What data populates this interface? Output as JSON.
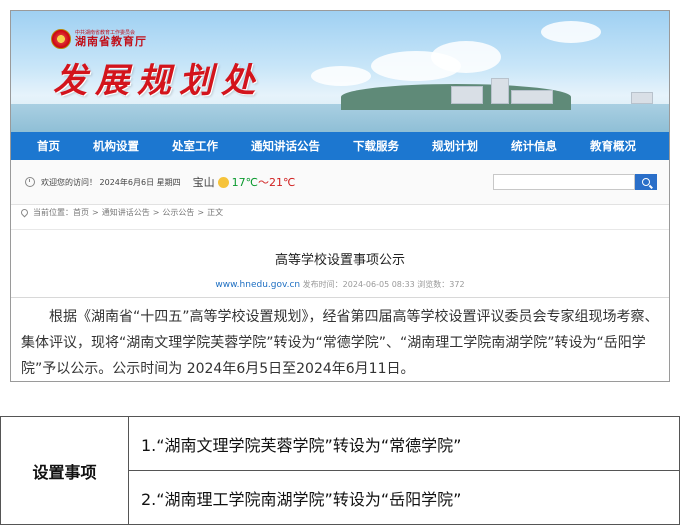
{
  "header": {
    "party_line": "中共湖南省教育工作委员会",
    "agency": "湖南省教育厅",
    "department": "发展规划处"
  },
  "nav": {
    "items": [
      "首页",
      "机构设置",
      "处室工作",
      "通知讲话公告",
      "下载服务",
      "规划计划",
      "统计信息",
      "教育概况"
    ]
  },
  "infobar": {
    "greeting": "欢迎您的访问！ 2024年6月6日 星期四",
    "city": "宝山",
    "temp_low": "17℃",
    "temp_sep": "～",
    "temp_high": "21℃",
    "search_placeholder": ""
  },
  "breadcrumb": {
    "label": "当前位置：",
    "items": [
      "首页",
      "通知讲话公告",
      "公示公告",
      "正文"
    ],
    "sep": ">"
  },
  "article": {
    "title": "高等学校设置事项公示",
    "site": "www.hnedu.gov.cn",
    "meta": "发布时间：2024-06-05 08:33 浏览数：372",
    "body": "根据《湖南省“十四五”高等学校设置规划》，经省第四届高等学校设置评议委员会专家组现场考察、集体评议，现将“湖南文理学院芙蓉学院”转设为“常德学院”、“湖南理工学院南湖学院”转设为“岳阳学院”予以公示。公示时间为 2024年6月5日至2024年6月11日。"
  },
  "table": {
    "header": "设置事项",
    "items": [
      "1.“湖南文理学院芙蓉学院”转设为“常德学院”",
      "2.“湖南理工学院南湖学院”转设为“岳阳学院”"
    ]
  },
  "colors": {
    "nav_bg": "#1c77d0",
    "title_red": "#d3141c",
    "link_blue": "#1e6fc2"
  }
}
